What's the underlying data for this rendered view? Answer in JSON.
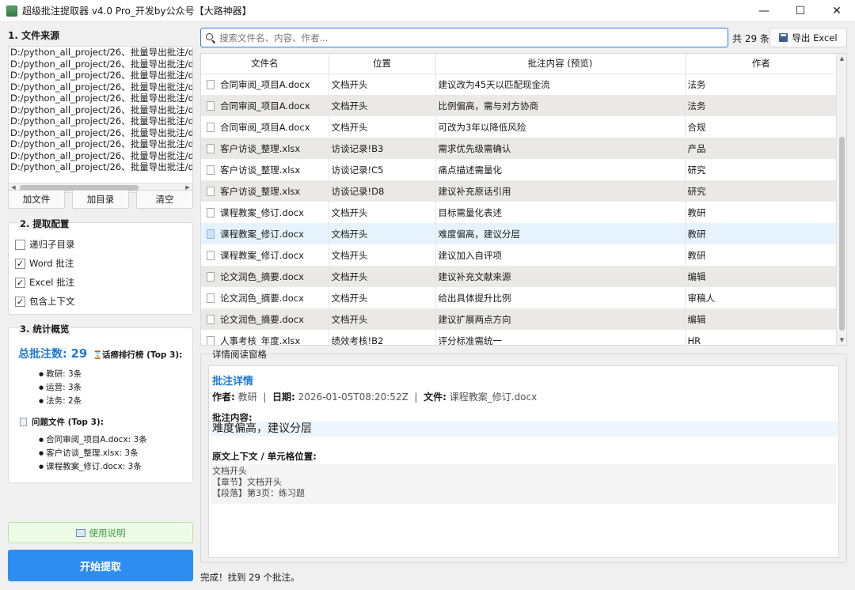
{
  "window": {
    "title": "超级批注提取器 v4.0 Pro_开发by公众号【大路神器】",
    "minimize": "—",
    "maximize": "☐",
    "close": "✕"
  },
  "left": {
    "section1_title": "1. 文件来源",
    "files": [
      "D:/python_all_project/26、批量导出批注/dem",
      "D:/python_all_project/26、批量导出批注/dem",
      "D:/python_all_project/26、批量导出批注/dem",
      "D:/python_all_project/26、批量导出批注/dem",
      "D:/python_all_project/26、批量导出批注/dem",
      "D:/python_all_project/26、批量导出批注/dem",
      "D:/python_all_project/26、批量导出批注/dem",
      "D:/python_all_project/26、批量导出批注/dem",
      "D:/python_all_project/26、批量导出批注/dem",
      "D:/python_all_project/26、批量导出批注/dem",
      "D:/python_all_project/26、批量导出批注/dem"
    ],
    "buttons": {
      "add_file": "加文件",
      "add_dir": "加目录",
      "clear": "清空"
    },
    "config": {
      "title": "2. 提取配置",
      "options": [
        {
          "label": "递归子目录",
          "checked": false
        },
        {
          "label": "Word 批注",
          "checked": true
        },
        {
          "label": "Excel 批注",
          "checked": true
        },
        {
          "label": "包含上下文",
          "checked": true
        }
      ]
    },
    "stats": {
      "title": "3. 统计概览",
      "total_label": "总批注数:",
      "total_value": "29",
      "rank_title": "话痨排行榜 (Top 3):",
      "rank": [
        "教研: 3条",
        "运营: 3条",
        "法务: 2条"
      ],
      "problem_title": "问题文件 (Top 3):",
      "problems": [
        "合同审阅_项目A.docx: 3条",
        "客户访谈_整理.xlsx: 3条",
        "课程教案_修订.docx: 3条"
      ]
    },
    "help_button": "使用说明",
    "start_button": "开始提取"
  },
  "toolbar": {
    "search_placeholder": "搜索文件名、内容、作者...",
    "count": "共 29 条",
    "export_button": "导出 Excel"
  },
  "table": {
    "headers": [
      "文件名",
      "位置",
      "批注内容 (预览)",
      "作者"
    ],
    "rows": [
      [
        "合同审阅_项目A.docx",
        "文档开头",
        "建议改为45天以匹配现金流",
        "法务"
      ],
      [
        "合同审阅_项目A.docx",
        "文档开头",
        "比例偏高，需与对方协商",
        "法务"
      ],
      [
        "合同审阅_项目A.docx",
        "文档开头",
        "可改为3年以降低风险",
        "合规"
      ],
      [
        "客户访谈_整理.xlsx",
        "访谈记录!B3",
        "需求优先级需确认",
        "产品"
      ],
      [
        "客户访谈_整理.xlsx",
        "访谈记录!C5",
        "痛点描述需量化",
        "研究"
      ],
      [
        "客户访谈_整理.xlsx",
        "访谈记录!D8",
        "建议补充原话引用",
        "研究"
      ],
      [
        "课程教案_修订.docx",
        "文档开头",
        "目标需量化表述",
        "教研"
      ],
      [
        "课程教案_修订.docx",
        "文档开头",
        "难度偏高，建议分层",
        "教研"
      ],
      [
        "课程教案_修订.docx",
        "文档开头",
        "建议加入自评项",
        "教研"
      ],
      [
        "论文润色_摘要.docx",
        "文档开头",
        "建议补充文献来源",
        "编辑"
      ],
      [
        "论文润色_摘要.docx",
        "文档开头",
        "给出具体提升比例",
        "审稿人"
      ],
      [
        "论文润色_摘要.docx",
        "文档开头",
        "建议扩展两点方向",
        "编辑"
      ],
      [
        "人事考核_年度.xlsx",
        "绩效考核!B2",
        "评分标准需统一",
        "HR"
      ]
    ],
    "selected_index": 7
  },
  "detail": {
    "pane_title": "详情阅读窗格",
    "heading": "批注详情",
    "author_label": "作者:",
    "author": "教研",
    "date_label": "日期:",
    "date": "2026-01-05T08:20:52Z",
    "file_label": "文件:",
    "file": "课程教案_修订.docx",
    "content_label": "批注内容:",
    "content": "难度偏高，建议分层",
    "context_label": "原文上下文 / 单元格位置:",
    "context_lines": [
      "文档开头",
      "【章节】文档开头",
      "【段落】第3页：练习题"
    ]
  },
  "status": "完成！找到 29 个批注。"
}
